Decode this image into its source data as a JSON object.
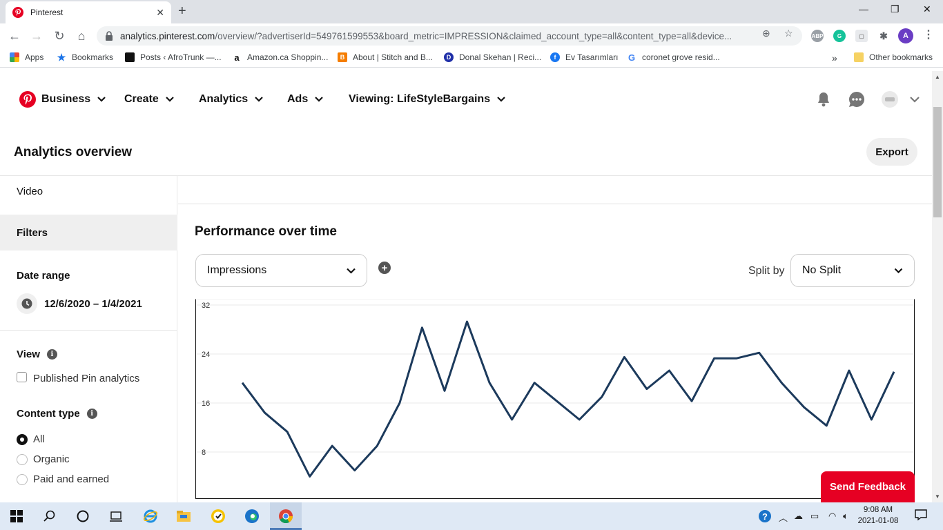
{
  "browser": {
    "tab_title": "Pinterest",
    "url_host": "analytics.pinterest.com",
    "url_rest": "/overview/?advertiserId=549761599553&board_metric=IMPRESSION&claimed_account_type=all&content_type=all&device...",
    "profile_initial": "A",
    "bookmarks": [
      {
        "label": "Apps"
      },
      {
        "label": "Bookmarks"
      },
      {
        "label": "Posts ‹ AfroTrunk —..."
      },
      {
        "label": "Amazon.ca Shoppin..."
      },
      {
        "label": "About | Stitch and B..."
      },
      {
        "label": "Donal Skehan | Reci..."
      },
      {
        "label": "Ev Tasarımları"
      },
      {
        "label": "coronet grove resid..."
      }
    ],
    "overflow": "»",
    "other_bookmarks": "Other bookmarks"
  },
  "nav": {
    "business": "Business",
    "create": "Create",
    "analytics": "Analytics",
    "ads": "Ads",
    "viewing": "Viewing: LifeStyleBargains"
  },
  "header": {
    "title": "Analytics overview",
    "export": "Export"
  },
  "sidebar": {
    "video": "Video",
    "filters": "Filters",
    "date_range_label": "Date range",
    "date_range_value": "12/6/2020 – 1/4/2021",
    "view_label": "View",
    "published_pin": "Published Pin analytics",
    "content_type_label": "Content type",
    "content_types": [
      "All",
      "Organic",
      "Paid and earned"
    ],
    "content_type_selected": "All"
  },
  "main": {
    "section_title": "Performance over time",
    "metric_select": "Impressions",
    "split_label": "Split by",
    "split_select": "No Split"
  },
  "feedback": "Send Feedback",
  "taskbar": {
    "time": "9:08 AM",
    "date": "2021-01-08"
  },
  "colors": {
    "pinterest_red": "#e60023",
    "line": "#1c3a5c"
  },
  "chart_data": {
    "type": "line",
    "title": "",
    "xlabel": "",
    "ylabel": "",
    "ylim": [
      0,
      32
    ],
    "yticks": [
      8,
      16,
      24,
      32
    ],
    "grid": true,
    "series": [
      {
        "values": [
          19.3,
          14.4,
          11.3,
          4,
          9,
          5,
          9,
          16,
          28.3,
          18,
          29.3,
          19.3,
          13.3,
          19.3,
          16.3,
          13.3,
          17,
          23.5,
          18.3,
          21.3,
          16.3,
          23.3,
          23.3,
          24.2,
          19.3,
          15.3,
          12.3,
          21.3,
          13.3,
          21.1
        ]
      }
    ]
  }
}
